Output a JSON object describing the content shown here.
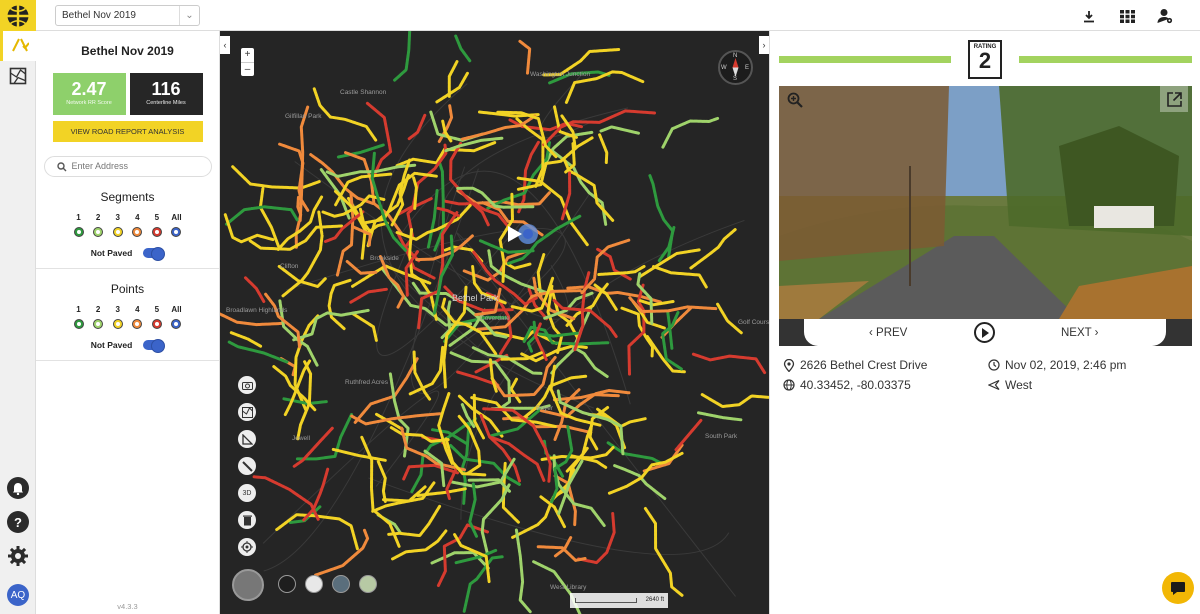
{
  "header": {
    "project_select": "Bethel Nov 2019",
    "icons": [
      "download-icon",
      "grid-icon",
      "user-settings-icon"
    ]
  },
  "rail": {
    "items": [
      "road-rating-icon",
      "map-layers-icon"
    ],
    "bottom": [
      "bell-icon",
      "help-icon",
      "gear-icon"
    ],
    "user_initials": "AQ"
  },
  "panel": {
    "title": "Bethel Nov 2019",
    "network_score": "2.47",
    "network_score_label": "Network RR Score",
    "centerline_miles": "116",
    "centerline_label": "Centerline Miles",
    "report_button": "VIEW ROAD REPORT ANALYSIS",
    "address_placeholder": "Enter Address",
    "segments_title": "Segments",
    "points_title": "Points",
    "rating_labels": [
      "1",
      "2",
      "3",
      "4",
      "5",
      "All"
    ],
    "rating_colors": [
      "#2e9a3e",
      "#9fd36b",
      "#f2d325",
      "#f08a3c",
      "#d63b2f",
      "#3b64c9"
    ],
    "not_paved_label": "Not Paved",
    "version": "v4.3.3"
  },
  "map": {
    "places": [
      {
        "name": "Washington Junction"
      },
      {
        "name": "Castle Shannon"
      },
      {
        "name": "Gilfillan Park"
      },
      {
        "name": "Clifton"
      },
      {
        "name": "Bethel Park",
        "big": true
      },
      {
        "name": "Broadlawn Highlands"
      },
      {
        "name": "Ruthfred Acres"
      },
      {
        "name": "South Park"
      },
      {
        "name": "Golf Course Park"
      },
      {
        "name": "Jewell"
      },
      {
        "name": "West Library"
      },
      {
        "name": "Brookside"
      },
      {
        "name": "Coverdale"
      },
      {
        "name": "Boyer"
      }
    ],
    "scale_label": "2640 ft",
    "tools": [
      "camera-icon",
      "road-map-icon",
      "ruler-icon",
      "measure-line-icon",
      "3d-icon",
      "trash-icon",
      "locate-icon"
    ]
  },
  "viewer": {
    "rating_label": "RATING",
    "rating_value": "2",
    "prev_label": "PREV",
    "next_label": "NEXT",
    "address": "2626 Bethel Crest Drive",
    "coordinates": "40.33452, -80.03375",
    "timestamp": "Nov 02, 2019, 2:46 pm",
    "direction": "West"
  }
}
